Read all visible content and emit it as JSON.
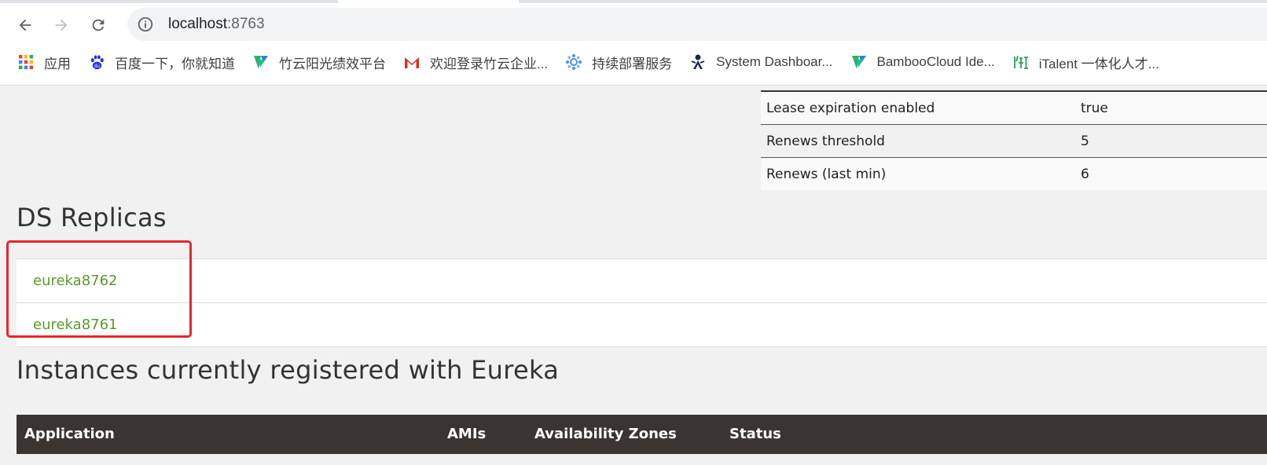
{
  "browser": {
    "url_host": "localhost",
    "url_port": ":8763",
    "bookmarks": [
      {
        "label": "应用",
        "icon": "apps-grid-icon"
      },
      {
        "label": "百度一下，你就知道",
        "icon": "baidu-paw-icon"
      },
      {
        "label": "竹云阳光绩效平台",
        "icon": "bamboocloud-icon"
      },
      {
        "label": "欢迎登录竹云企业...",
        "icon": "gmail-icon"
      },
      {
        "label": "持续部署服务",
        "icon": "deploy-gear-icon"
      },
      {
        "label": "System Dashboar...",
        "icon": "jira-icon"
      },
      {
        "label": "BambooCloud Ide...",
        "icon": "bamboocloud-icon"
      },
      {
        "label": "iTalent 一体化人才...",
        "icon": "italent-icon"
      }
    ]
  },
  "lease_info": [
    {
      "label": "Lease expiration enabled",
      "value": "true"
    },
    {
      "label": "Renews threshold",
      "value": "5"
    },
    {
      "label": "Renews (last min)",
      "value": "6"
    }
  ],
  "ds_replicas": {
    "title": "DS Replicas",
    "items": [
      "eureka8762",
      "eureka8761"
    ]
  },
  "instances": {
    "title": "Instances currently registered with Eureka",
    "columns": [
      "Application",
      "AMIs",
      "Availability Zones",
      "Status"
    ]
  },
  "colors": {
    "link_green": "#5a9a2a",
    "highlight_red": "#e8262b",
    "table_header_dark": "#3a3530"
  }
}
